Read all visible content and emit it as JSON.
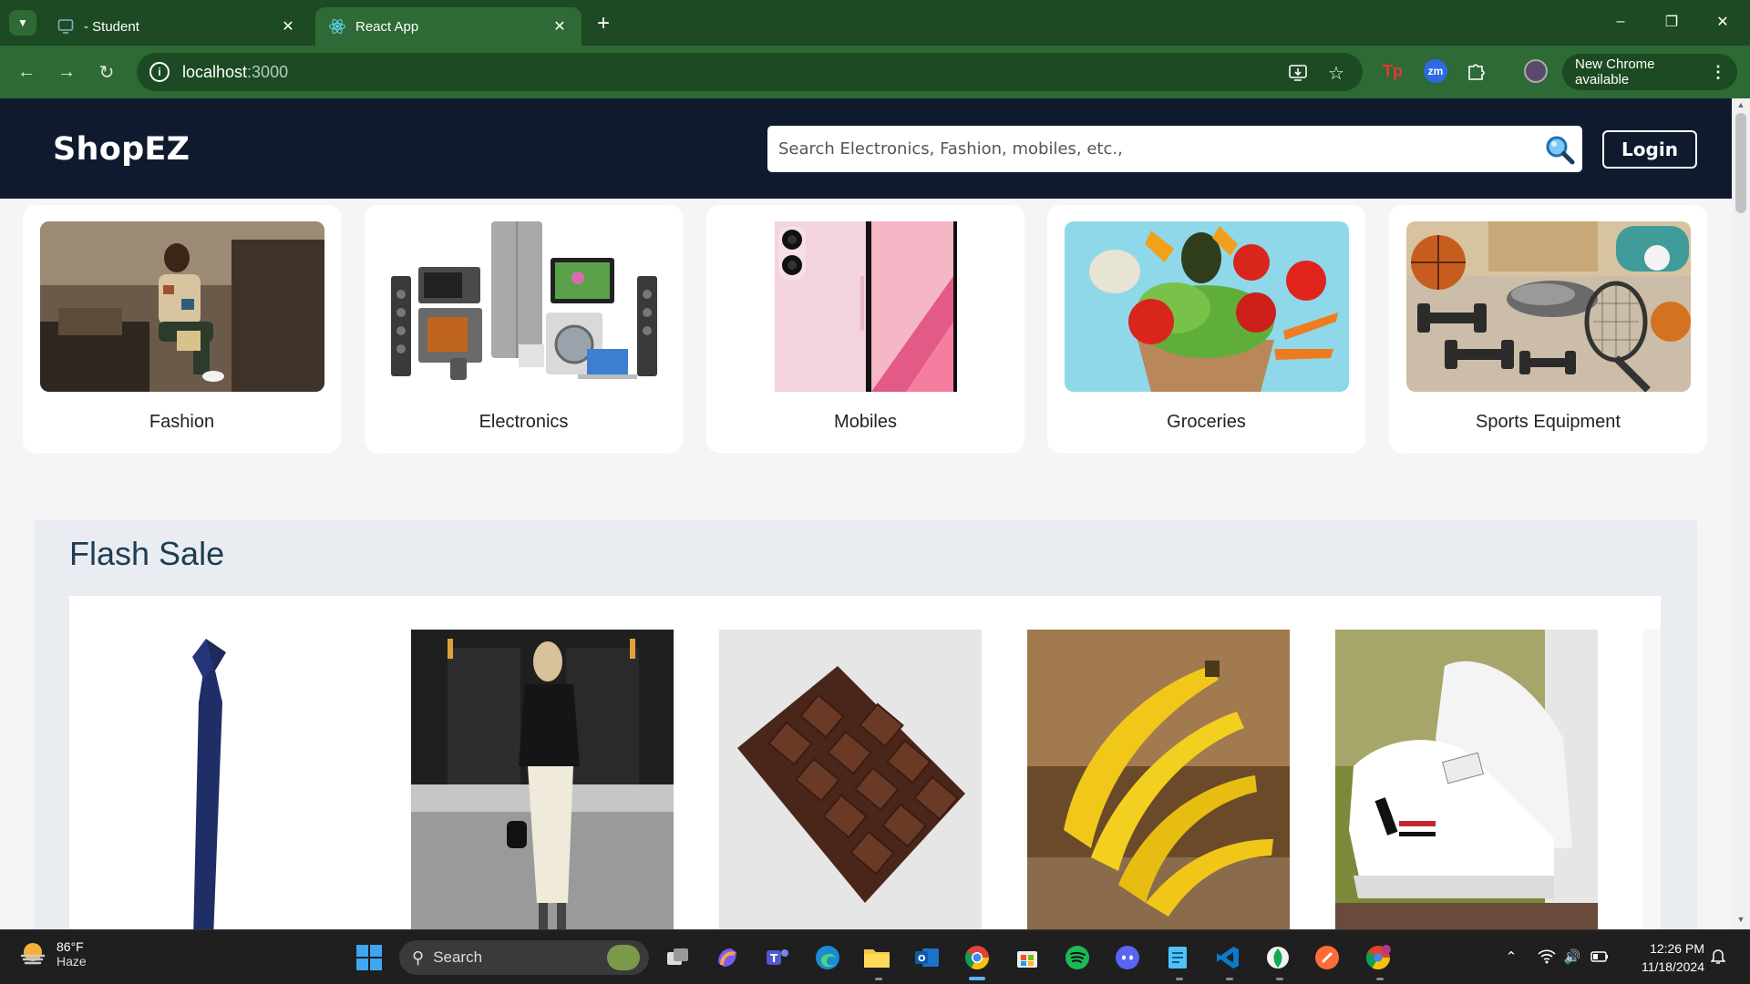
{
  "browser": {
    "tabs": [
      {
        "label": "- Student",
        "favicon": "monitor-icon",
        "active": false
      },
      {
        "label": "React App",
        "favicon": "react-atom-icon",
        "active": true
      }
    ],
    "address": {
      "host": "localhost",
      "port": ":3000"
    },
    "update_label": "New Chrome available"
  },
  "site": {
    "logo": "ShopEZ",
    "search_placeholder": "Search Electronics, Fashion, mobiles, etc.,",
    "login_label": "Login",
    "categories": [
      {
        "label": "Fashion",
        "image": "fashion-photo"
      },
      {
        "label": "Electronics",
        "image": "electronics-photo"
      },
      {
        "label": "Mobiles",
        "image": "mobile-phone-photo"
      },
      {
        "label": "Groceries",
        "image": "groceries-photo"
      },
      {
        "label": "Sports Equipment",
        "image": "sports-equipment-photo"
      }
    ],
    "flash_sale": {
      "title": "Flash Sale",
      "products": [
        "necktie-photo",
        "woman-outfit-photo",
        "chocolate-bar-photo",
        "bananas-photo",
        "sneakers-photo"
      ]
    }
  },
  "taskbar": {
    "weather": {
      "temp": "86°F",
      "condition": "Haze"
    },
    "search_label": "Search",
    "time": "12:26 PM",
    "date": "11/18/2024"
  },
  "colors": {
    "chrome_frame": "#1d4a22",
    "chrome_toolbar": "#2d6a35",
    "site_header": "#0f1a2e",
    "flash_bg": "#e9edf1",
    "flash_title": "#1f3d52"
  }
}
